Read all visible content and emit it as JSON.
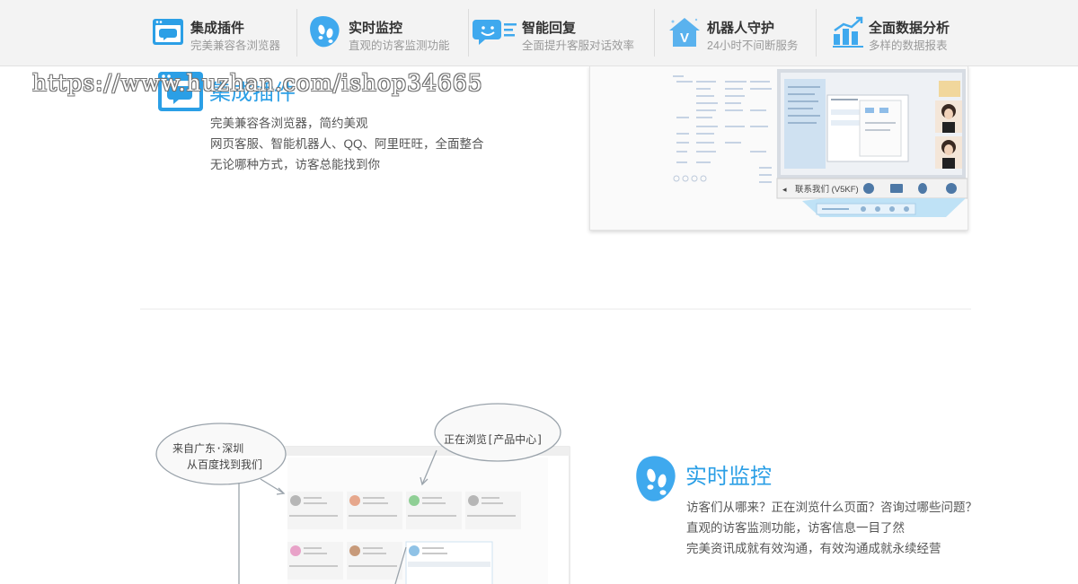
{
  "nav": {
    "items": [
      {
        "title": "集成插件",
        "subtitle": "完美兼容各浏览器",
        "icon": "browser-plugin-icon"
      },
      {
        "title": "实时监控",
        "subtitle": "直观的访客监测功能",
        "icon": "footprints-icon"
      },
      {
        "title": "智能回复",
        "subtitle": "全面提升客服对话效率",
        "icon": "smile-chat-icon"
      },
      {
        "title": "机器人守护",
        "subtitle": "24小时不间断服务",
        "icon": "robot-guard-icon"
      },
      {
        "title": "全面数据分析",
        "subtitle": "多样的数据报表",
        "icon": "bar-chart-icon"
      }
    ]
  },
  "watermark": "https://www.huzhan.com/ishop34665",
  "section1": {
    "title": "集成插件",
    "lines": [
      "完美兼容各浏览器，简约美观",
      "网页客服、智能机器人、QQ、阿里旺旺，全面整合",
      "无论哪种方式，访客总能找到你"
    ],
    "contact_label": "联系我们 (V5KF)",
    "icon": "browser-plugin-icon"
  },
  "section2": {
    "title": "实时监控",
    "lines": [
      "访客们从哪来？正在浏览什么页面？咨询过哪些问题？",
      "直观的访客监测功能，访客信息一目了然",
      "完美资讯成就有效沟通，有效沟通成就永续经营"
    ],
    "bubble_left": [
      "来自广东·深圳",
      "从百度找到我们"
    ],
    "bubble_right": "正在浏览[产品中心]",
    "icon": "footprints-icon"
  },
  "colors": {
    "accent": "#2b9fe6",
    "nav_bg": "#f3f3f3",
    "text": "#555555"
  }
}
